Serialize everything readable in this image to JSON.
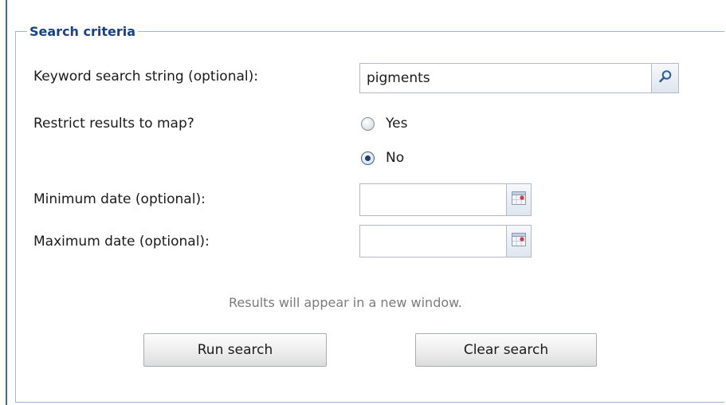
{
  "fieldset": {
    "legend": "Search criteria"
  },
  "keyword": {
    "label": "Keyword search string (optional):",
    "value": "pigments",
    "search_icon": "magnifier-icon"
  },
  "restrict": {
    "label": "Restrict results to map?",
    "options": [
      {
        "label": "Yes",
        "checked": false
      },
      {
        "label": "No",
        "checked": true
      }
    ]
  },
  "min_date": {
    "label": "Minimum date (optional):",
    "value": "",
    "icon": "calendar-icon"
  },
  "max_date": {
    "label": "Maximum date (optional):",
    "value": "",
    "icon": "calendar-icon"
  },
  "hint": "Results will appear in a new window.",
  "buttons": {
    "run": "Run search",
    "clear": "Clear search"
  },
  "colors": {
    "legend": "#15428b",
    "field_border": "#b5b8c8",
    "hint_text": "#7b7b7b"
  }
}
